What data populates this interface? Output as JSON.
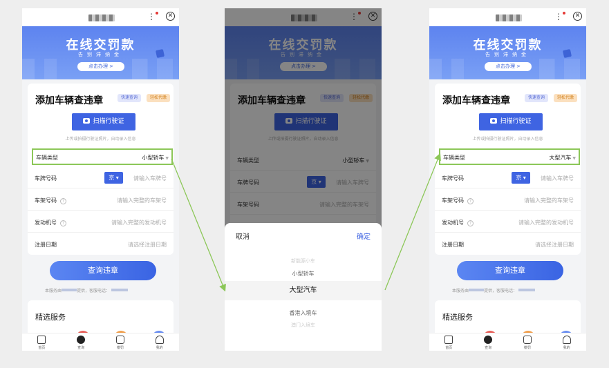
{
  "banner": {
    "title": "在线交罚款",
    "subtitle": "告别滞纳金",
    "button": "点击办理 >"
  },
  "form": {
    "title": "添加车辆查违章",
    "tag_fast": "快速查询",
    "tag_easy": "轻松代缴",
    "scan_button": "扫描行驶证",
    "scan_tip": "上传或拍摄行驶证照片，自动录入信息",
    "vehicle_type_label": "车辆类型",
    "plate_label": "车牌号码",
    "plate_province": "京",
    "plate_placeholder": "请输入车牌号",
    "frame_label": "车架号码",
    "frame_placeholder": "请输入完整的车架号",
    "engine_label": "发动机号",
    "engine_placeholder": "请输入完整的发动机号",
    "register_label": "注册日期",
    "register_placeholder": "请选择注册日期",
    "query_button": "查询违章",
    "provider_prefix": "本服务由",
    "provider_suffix": "提供，客服电话：",
    "services_title": "精选服务"
  },
  "screens": [
    {
      "vehicle_type_value": "小型轿车"
    },
    {
      "vehicle_type_value": "小型轿车"
    },
    {
      "vehicle_type_value": "大型汽车"
    }
  ],
  "tabbar": {
    "home": "首页",
    "query": "查询",
    "pay": "缴罚",
    "mine": "我的"
  },
  "picker": {
    "cancel": "取消",
    "confirm": "确定",
    "options": [
      "新能源小车",
      "小型轿车",
      "大型汽车",
      "香港入境车",
      "澳门入境车"
    ],
    "selected_index": 2
  },
  "colors": {
    "primary": "#3f64e2",
    "highlight": "#8cc758",
    "tag_blue": "#e2e6fb",
    "tag_orange": "#fbe0bf"
  }
}
